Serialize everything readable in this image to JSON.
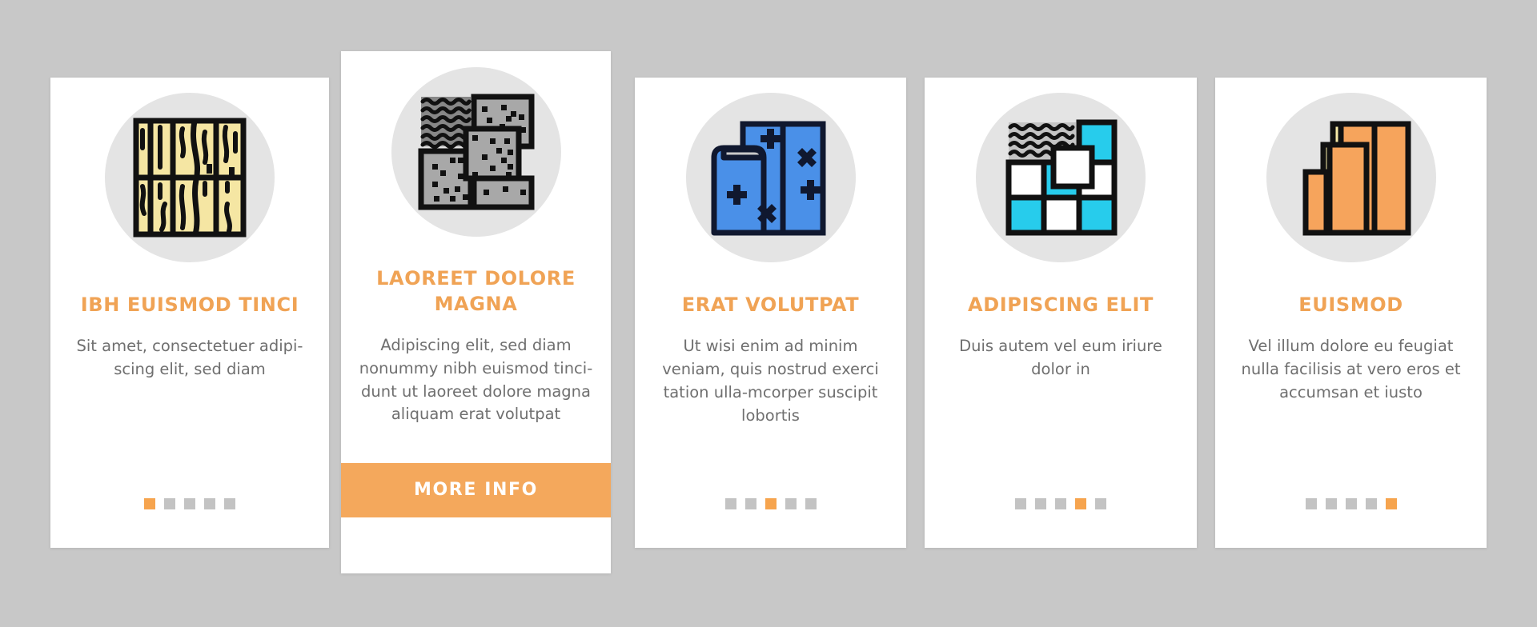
{
  "page": {
    "background_color": "#c8c8c8",
    "accent_color": "#f0a355",
    "card_background": "#ffffff",
    "body_text_color": "#6f6f6f",
    "dot_inactive_color": "#c3c3c3",
    "dot_active_color": "#f6a44e"
  },
  "cards": [
    {
      "icon_name": "wood-grain-plank-icon",
      "title": "IBH EUISMOD TINCI",
      "body": "Sit amet, consectetuer adipi-scing elit, sed diam",
      "dots": {
        "count": 5,
        "active_index": 0
      },
      "has_button": false
    },
    {
      "icon_name": "stone-tile-pattern-icon",
      "title": "LAOREET DOLORE MAGNA",
      "body": "Adipiscing elit, sed diam nonummy nibh euismod tinci-dunt ut laoreet dolore magna aliquam erat volutpat",
      "dots": null,
      "has_button": true,
      "button_label": "MORE INFO"
    },
    {
      "icon_name": "carpet-roll-icon",
      "title": "ERAT VOLUTPAT",
      "body": "Ut wisi enim ad minim veniam, quis nostrud exerci tation ulla-mcorper suscipit lobortis",
      "dots": {
        "count": 5,
        "active_index": 2
      },
      "has_button": false
    },
    {
      "icon_name": "ceramic-tile-grid-icon",
      "title": "ADIPISCING ELIT",
      "body": "Duis autem vel eum iriure dolor in",
      "dots": {
        "count": 5,
        "active_index": 3
      },
      "has_button": false
    },
    {
      "icon_name": "laminate-board-stack-icon",
      "title": "EUISMOD",
      "body": "Vel illum dolore eu feugiat nulla facilisis at vero eros et accumsan et iusto",
      "dots": {
        "count": 5,
        "active_index": 4
      },
      "has_button": false
    }
  ],
  "icon_colors": {
    "wood_fill": "#f5e6a3",
    "stone_fill": "#a8a8a8",
    "stone_dark": "#878787",
    "carpet_fill": "#4a90e8",
    "carpet_dark": "#10182f",
    "tile_cyan": "#27ccec",
    "tile_white": "#ffffff",
    "tile_gray": "#c4c4c4",
    "laminate_fill": "#f6a45c",
    "laminate_light": "#f6eaa8",
    "outline": "#111111",
    "disc": "#e4e4e4"
  }
}
